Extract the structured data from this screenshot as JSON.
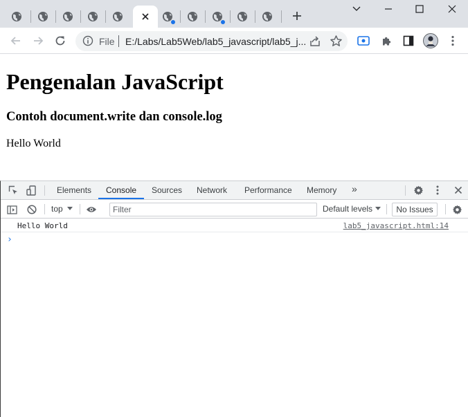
{
  "browser": {
    "tabs": [
      {
        "icon": "globe-icon"
      },
      {
        "icon": "globe-icon"
      },
      {
        "icon": "globe-icon"
      },
      {
        "icon": "globe-icon"
      },
      {
        "icon": "globe-icon"
      },
      {
        "icon": "close-icon",
        "active": true
      },
      {
        "icon": "globe-icon",
        "notification": true
      },
      {
        "icon": "globe-icon"
      },
      {
        "icon": "globe-icon",
        "notification": true
      },
      {
        "icon": "globe-icon"
      },
      {
        "icon": "globe-icon"
      }
    ],
    "new_tab_icon": "plus-icon",
    "window_controls": [
      "chevron-down-icon",
      "minimize-icon",
      "maximize-icon",
      "close-icon"
    ]
  },
  "toolbar": {
    "back_icon": "arrow-left-icon",
    "forward_icon": "arrow-right-icon",
    "reload_icon": "reload-icon",
    "scheme_label": "File",
    "url": "E:/Labs/Lab5Web/lab5_javascript/lab5_j...",
    "extension_icons": [
      "screencast-icon",
      "puzzle-icon",
      "side-panel-icon",
      "avatar"
    ]
  },
  "page": {
    "heading": "Pengenalan JavaScript",
    "subheading": "Contoh document.write dan console.log",
    "body_text": "Hello World"
  },
  "devtools": {
    "tabs": [
      "Elements",
      "Console",
      "Sources",
      "Network",
      "Performance",
      "Memory"
    ],
    "active_tab": "Console",
    "more_tabs_label": "»",
    "context": "top",
    "filter_placeholder": "Filter",
    "levels_label": "Default levels",
    "issues_label": "No Issues",
    "console": [
      {
        "message": "Hello World",
        "source": "lab5_javascript.html:14"
      }
    ],
    "prompt_symbol": "›",
    "accent_color": "#1a73e8"
  }
}
